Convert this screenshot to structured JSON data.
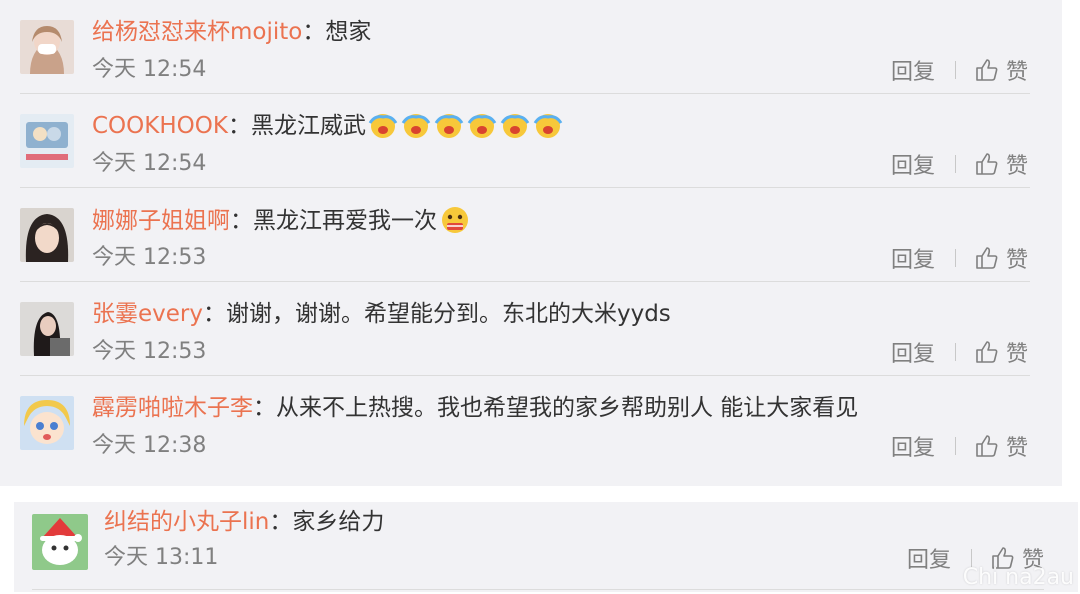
{
  "comments": [
    {
      "user": "给杨怼怼来杯mojito",
      "text": "想家",
      "time": "今天 12:54",
      "emoji_count": 0
    },
    {
      "user": "COOKHOOK",
      "text": "黑龙江威武",
      "time": "今天 12:54",
      "emoji_count": 6
    },
    {
      "user": "娜娜子姐姐啊",
      "text": "黑龙江再爱我一次",
      "time": "今天 12:53",
      "emoji_count": 1
    },
    {
      "user": "张霎every",
      "text": "谢谢，谢谢。希望能分到。东北的大米yyds",
      "time": "今天 12:53",
      "emoji_count": 0
    },
    {
      "user": "霹雳啪啦木子李",
      "text": "从来不上热搜。我也希望我的家乡帮助别人 能让大家看见",
      "time": "今天 12:38",
      "emoji_count": 0
    },
    {
      "user": "纠结的小丸子lin",
      "text": "家乡给力",
      "time": "今天 13:11",
      "emoji_count": 0
    }
  ],
  "actions": {
    "reply": "回复",
    "like": "赞",
    "colon": "："
  },
  "watermark": "Chi na2au",
  "colors": {
    "username": "#eb7350",
    "panel": "#f2f2f5"
  }
}
